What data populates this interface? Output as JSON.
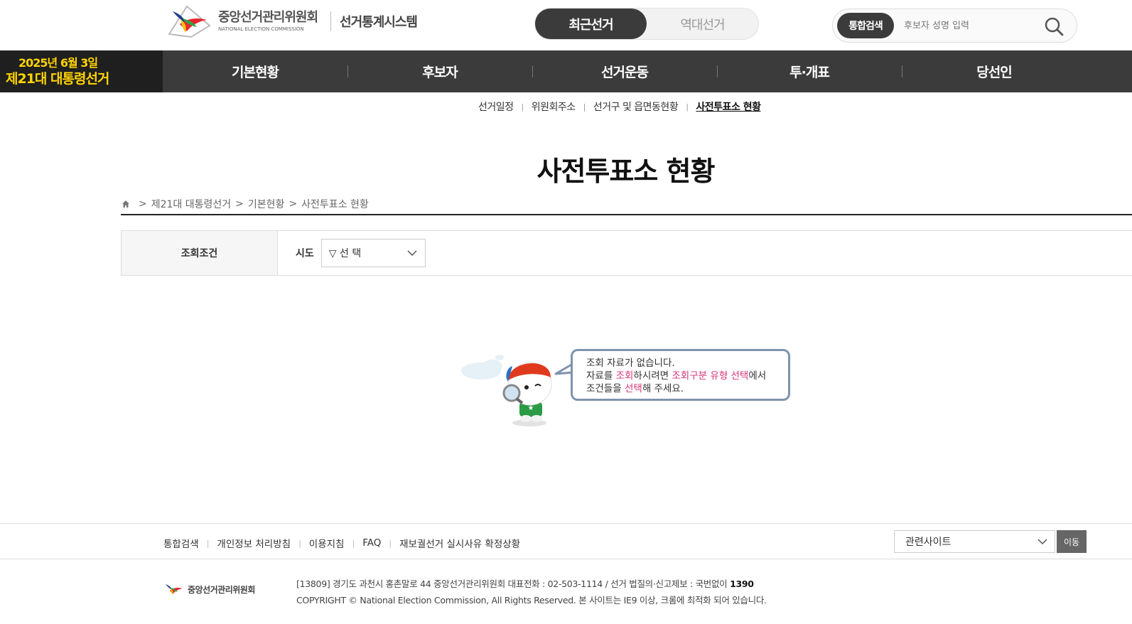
{
  "header": {
    "logo_ko": "중앙선거관리위원회",
    "logo_en": "NATIONAL ELECTION COMMISSION",
    "system_title": "선거통계시스템",
    "toggle": {
      "recent": "최근선거",
      "past": "역대선거"
    },
    "search": {
      "badge": "통합검색",
      "placeholder": "후보자 성명 입력"
    }
  },
  "election": {
    "date": "2025년 6월 3일",
    "name": "제21대 대통령선거"
  },
  "gnb": [
    "기본현황",
    "후보자",
    "선거운동",
    "투·개표",
    "당선인"
  ],
  "subnav": [
    "선거일정",
    "위원회주소",
    "선거구 및 읍면동현황",
    "사전투표소 현황"
  ],
  "page": {
    "title": "사전투표소 현황",
    "breadcrumb": [
      "제21대 대통령선거",
      "기본현황",
      "사전투표소 현황"
    ]
  },
  "condition": {
    "label": "조회조건",
    "sido_label": "시도",
    "sido_value": "▽ 선 택"
  },
  "empty": {
    "line1": "조회 자료가 없습니다.",
    "line2_a": "자료를 ",
    "line2_b": "조회",
    "line2_c": "하시려면 ",
    "line2_d": "조회구분 유형 선택",
    "line2_e": "에서",
    "line3_a": "조건들을 ",
    "line3_b": "선택",
    "line3_c": "해 주세요."
  },
  "footer": {
    "links": [
      "통합검색",
      "개인정보 처리방침",
      "이용지침",
      "FAQ",
      "재보궐선거 실시사유 확정상황"
    ],
    "related": "관련사이트",
    "go": "이동",
    "logo": "중앙선거관리위원회",
    "address_a": "[13809] 경기도 과천시 홍촌말로 44 중앙선거관리위원회 대표전화 : 02-503-1114 / 선거 법질의·신고제보 : 국번없이 ",
    "address_b": "1390",
    "copyright": "COPYRIGHT © National Election Commission, All Rights Reserved. 본 사이트는 IE9 이상, 크롬에 최적화 되어 있습니다."
  },
  "colors": {
    "dark": "#3b3b3b",
    "badge_yellow": "#ffd400",
    "highlight": "#d6337a",
    "bubble_border": "#7f93ac"
  }
}
